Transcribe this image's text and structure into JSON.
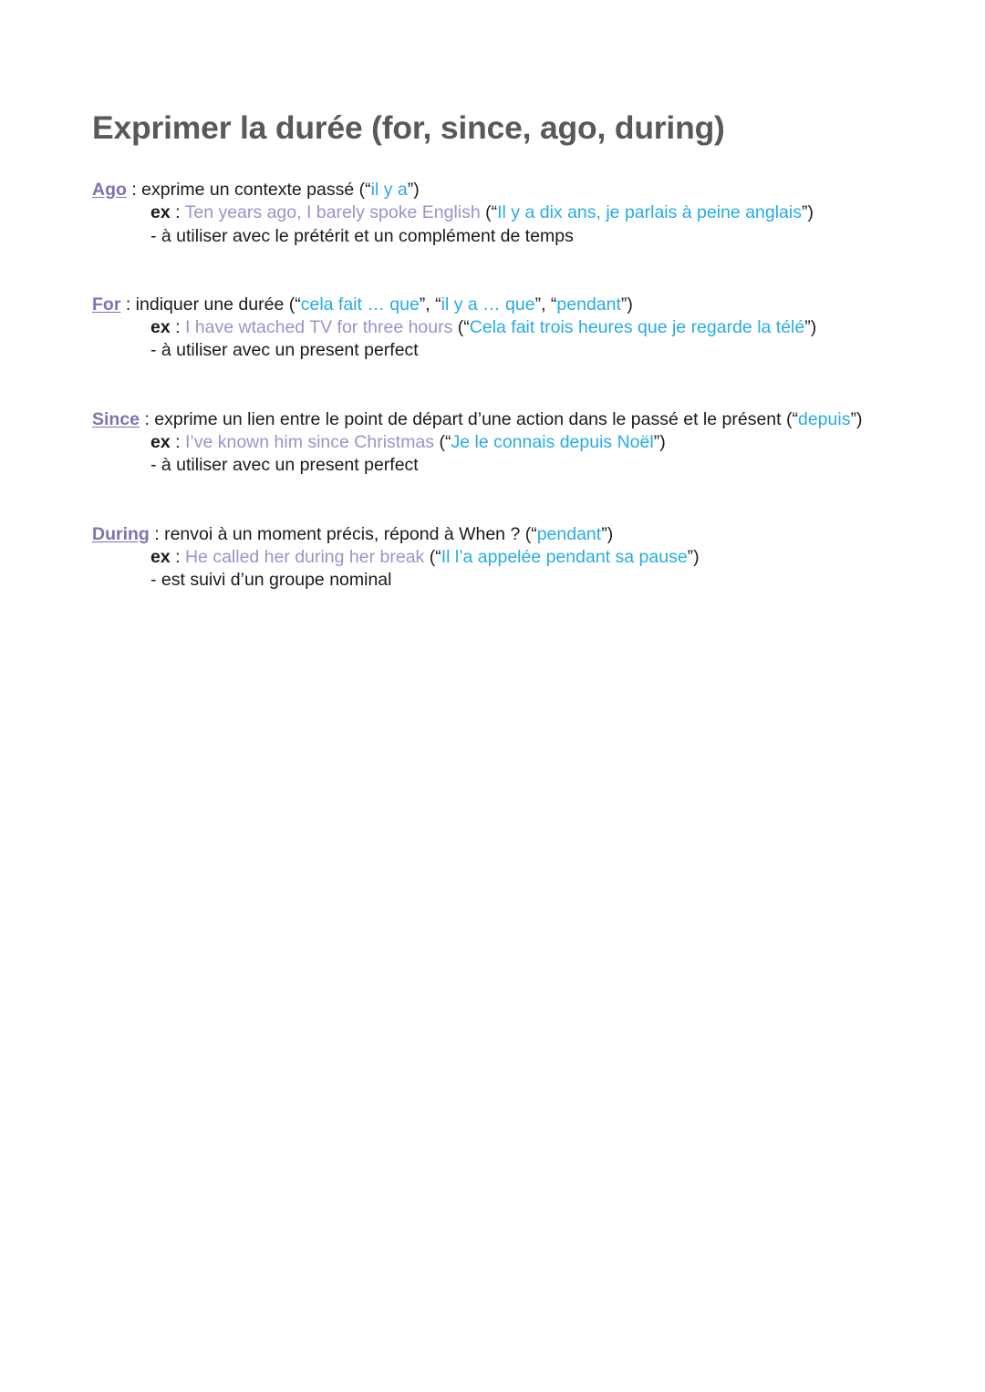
{
  "document": {
    "title": "Exprimer la durée (for, since, ago, during)",
    "colors": {
      "keyword_purple": "#7d74b0",
      "french_cyan": "#29abe2",
      "english_light_purple": "#9b93c8",
      "body_text": "#1a1a1a",
      "title_gray": "#58595b",
      "background": "#ffffff"
    }
  },
  "sections": [
    {
      "keyword": "Ago",
      "definition_before": " : exprime un contexte passé (“",
      "definition_french": "il y a",
      "definition_after": "”)",
      "example_label": "ex",
      "example_sep": " : ",
      "example_english": "Ten years ago, I barely spoke English",
      "example_open": " (“",
      "example_french": "Il y a dix ans, je parlais à peine anglais",
      "example_close": "”)",
      "note": "- à utiliser avec le prétérit et un complément de temps"
    },
    {
      "keyword": "For",
      "definition_before": " : indiquer une durée (“",
      "definition_french": "cela fait … que",
      "definition_mid1": "”, “",
      "definition_french2": "il y a … que",
      "definition_mid2": "”, “",
      "definition_french3": "pendant",
      "definition_after": "”)",
      "example_label": "ex",
      "example_sep": " : ",
      "example_english": "I have wtached TV for three hours",
      "example_open": " (“",
      "example_french": "Cela fait trois heures que je regarde la télé",
      "example_close": "”)",
      "note": "- à utiliser avec un present perfect"
    },
    {
      "keyword": "Since",
      "definition_before": " : exprime un lien entre le point de départ d’une action dans le passé et le présent (“",
      "definition_french": "depuis",
      "definition_after": "”)",
      "example_label": "ex",
      "example_sep": " : ",
      "example_english": "I’ve known him since Christmas",
      "example_open": " (“",
      "example_french": "Je le connais depuis Noël",
      "example_close": "”)",
      "note": "- à utiliser avec un present perfect"
    },
    {
      "keyword": "During",
      "definition_before": " : renvoi à un moment précis, répond à When ? (“",
      "definition_french": "pendant",
      "definition_after": "”)",
      "example_label": "ex",
      "example_sep": " : ",
      "example_english": "He called her during her break",
      "example_open": " (“",
      "example_french": "Il l’a appelée pendant sa pause",
      "example_close": "”)",
      "note": "- est suivi d’un groupe nominal"
    }
  ]
}
